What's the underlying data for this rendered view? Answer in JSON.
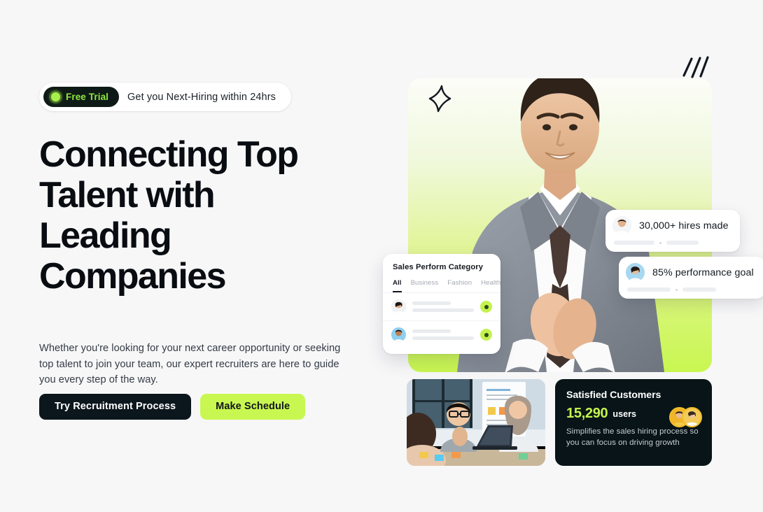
{
  "theme": {
    "background": "#f7f7f8",
    "accent_lime": "#c9f751",
    "dark": "#0c161d",
    "text": "#090d12"
  },
  "hero": {
    "badge": {
      "chip_label": "Free Trial",
      "chip_icon": "status-dot-icon",
      "message": "Get you Next-Hiring within 24hrs"
    },
    "headline": "Connecting Top Talent with Leading Companies",
    "paragraph": "Whether you're looking for your next career opportunity or seeking top talent to join your team, our expert recruiters are here to guide you every step of the way.",
    "cta": {
      "primary_label": "Try Recruitment Process",
      "secondary_label": "Make Schedule"
    },
    "decorations": {
      "sparkle": "sparkle-icon",
      "slashes": "diagonal-slashes-icon"
    },
    "photo_alt": "smiling businessman in grey suit clapping hands"
  },
  "stat_badges": [
    {
      "label": "30,000+ hires made",
      "avatar": "woman-avatar",
      "name": "badge-hires-made"
    },
    {
      "label": "85% performance goal",
      "avatar": "woman-avatar",
      "name": "badge-performance-goal"
    }
  ],
  "category_card": {
    "title": "Sales Perform Category",
    "tabs": [
      {
        "label": "All",
        "active": true
      },
      {
        "label": "Business",
        "active": false
      },
      {
        "label": "Fashion",
        "active": false
      },
      {
        "label": "Health",
        "active": false
      }
    ],
    "rows": [
      {
        "avatar": "woman-avatar-dark-hair",
        "status_icon": "check-circle-icon"
      },
      {
        "avatar": "woman-avatar-blue-bg",
        "status_icon": "check-circle-icon"
      }
    ]
  },
  "team_photo": {
    "alt": "team of three colleagues collaborating at a desk with laptop and whiteboard",
    "name": "team-meeting-photo"
  },
  "customers_card": {
    "title": "Satisfied Customers",
    "count": "15,290",
    "count_unit": "users",
    "description": "Simplifies the sales hiring process so you can focus on driving growth",
    "avatars": [
      "customer-avatar-1",
      "customer-avatar-2"
    ]
  }
}
